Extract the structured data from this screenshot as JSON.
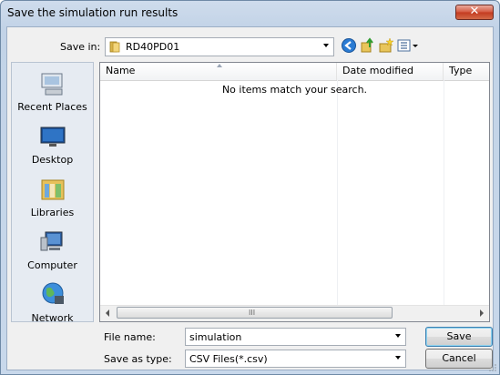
{
  "window": {
    "title": "Save the simulation run results",
    "close_glyph": "✕"
  },
  "toolbar": {
    "save_in_label": "Save in:",
    "save_in_value": "RD40PD01",
    "icons": [
      "back-icon",
      "up-folder-icon",
      "new-folder-icon",
      "views-menu-icon"
    ]
  },
  "places": [
    {
      "label": "Recent Places",
      "icon": "recent-places-icon"
    },
    {
      "label": "Desktop",
      "icon": "desktop-icon"
    },
    {
      "label": "Libraries",
      "icon": "libraries-icon"
    },
    {
      "label": "Computer",
      "icon": "computer-icon"
    },
    {
      "label": "Network",
      "icon": "network-icon"
    }
  ],
  "file_list": {
    "columns": [
      "Name",
      "Date modified",
      "Type"
    ],
    "empty_message": "No items match your search."
  },
  "form": {
    "file_name_label": "File name:",
    "file_name_value": "simulation",
    "save_type_label": "Save as type:",
    "save_type_value": "CSV Files(*.csv)"
  },
  "buttons": {
    "save": "Save",
    "cancel": "Cancel"
  },
  "scrollbar": {
    "grip": "III"
  },
  "colors": {
    "accent": "#3c7fb1",
    "close_button": "#c33a1f"
  }
}
